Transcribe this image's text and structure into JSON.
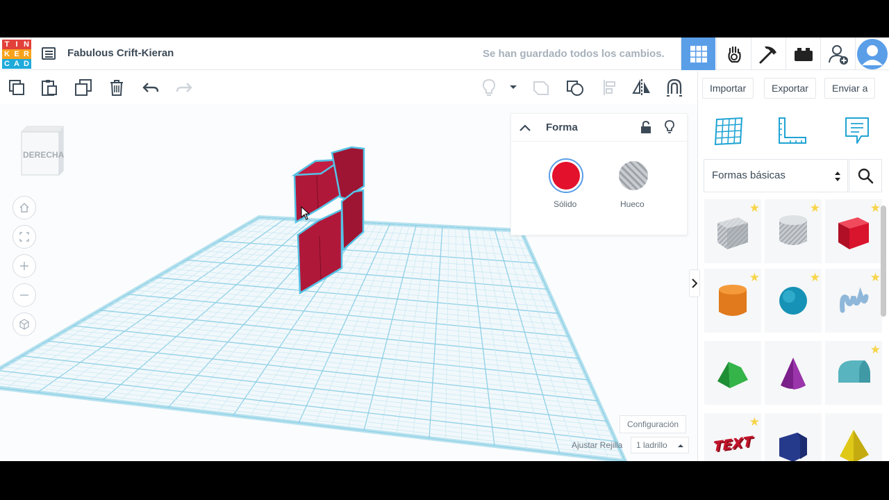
{
  "header": {
    "logo_letters": [
      "T",
      "I",
      "N",
      "K",
      "E",
      "R",
      "C",
      "A",
      "D"
    ],
    "logo_colors": [
      "#e2413b",
      "#e2413b",
      "#e2413b",
      "#f7a21b",
      "#f7a21b",
      "#f7a21b",
      "#1eaadb",
      "#1eaadb",
      "#1eaadb"
    ],
    "title": "Fabulous Crift-Kieran",
    "save_status": "Se han guardado todos los cambios.",
    "accent": "#5a9ee8"
  },
  "toolbar": {
    "right_buttons": {
      "import": "Importar",
      "export": "Exportar",
      "send": "Enviar a"
    }
  },
  "viewcube": {
    "label": "DERECHA"
  },
  "inspector": {
    "title": "Forma",
    "solid_label": "Sólido",
    "hole_label": "Hueco",
    "solid_color": "#e3112c"
  },
  "workplane": {
    "settings_label": "Configuración",
    "snap_label": "Ajustar Rejilla",
    "snap_value": "1 ladrillo"
  },
  "sidebar": {
    "category": "Formas básicas"
  },
  "shapes": [
    {
      "name": "box-hole",
      "starred": true
    },
    {
      "name": "cylinder-hole",
      "starred": true
    },
    {
      "name": "box",
      "starred": true
    },
    {
      "name": "cylinder",
      "starred": true
    },
    {
      "name": "sphere",
      "starred": true
    },
    {
      "name": "scribble",
      "starred": true
    },
    {
      "name": "roof",
      "starred": false
    },
    {
      "name": "cone",
      "starred": false
    },
    {
      "name": "round-roof",
      "starred": true
    },
    {
      "name": "text",
      "starred": true
    },
    {
      "name": "polygon",
      "starred": false
    },
    {
      "name": "pyramid",
      "starred": false
    }
  ],
  "shape_text_sample": "TEXT"
}
